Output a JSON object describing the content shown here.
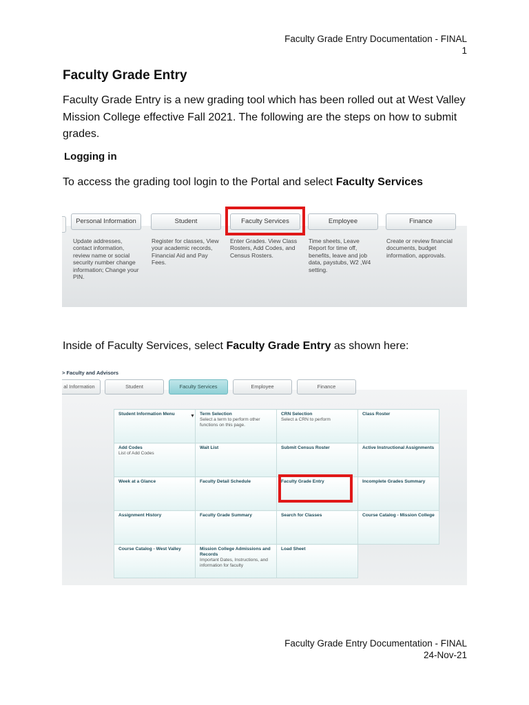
{
  "header": {
    "line1": "Faculty Grade Entry Documentation - FINAL",
    "line2": "1"
  },
  "title": "Faculty Grade Entry",
  "intro": "Faculty Grade Entry is a new grading tool which has been rolled out at West Valley Mission College effective Fall 2021.  The following are the steps on how to submit grades.",
  "logging_heading": "Logging in",
  "login_text": {
    "before": "To access the grading tool login to the Portal and select ",
    "bold": "Faculty Services"
  },
  "portal_tabs": [
    {
      "label": "Personal Information",
      "desc": "Update addresses, contact information, review name or social security number change information; Change your PIN."
    },
    {
      "label": "Student",
      "desc": "Register for classes, View your academic records, Financial Aid and Pay Fees."
    },
    {
      "label": "Faculty Services",
      "desc": "Enter Grades. View Class Rosters, Add Codes, and Census Rosters."
    },
    {
      "label": "Employee",
      "desc": "Time sheets, Leave Report for time off, benefits, leave and job data, paystubs, W2 ,W4 setting."
    },
    {
      "label": "Finance",
      "desc": "Create or review financial documents, budget information, approvals."
    }
  ],
  "inside_text": {
    "before": "Inside of Faculty Services, select ",
    "bold": "Faculty Grade Entry",
    "after": " as shown here:"
  },
  "faculty_menu": {
    "breadcrumb": "> Faculty and Advisors",
    "tabs": [
      "al Information",
      "Student",
      "Faculty Services",
      "Employee",
      "Finance"
    ],
    "rows": [
      [
        {
          "title": "Student Information Menu",
          "desc": ""
        },
        {
          "title": "Term Selection",
          "desc": "Select a term to perform other functions on this page."
        },
        {
          "title": "CRN Selection",
          "desc": "Select a CRN to perform"
        },
        {
          "title": "Class Roster",
          "desc": ""
        }
      ],
      [
        {
          "title": "Add Codes",
          "desc": "List of Add Codes"
        },
        {
          "title": "Wait List",
          "desc": ""
        },
        {
          "title": "Submit Census Roster",
          "desc": ""
        },
        {
          "title": "Active Instructional Assignments",
          "desc": ""
        }
      ],
      [
        {
          "title": "Week at a Glance",
          "desc": ""
        },
        {
          "title": "Faculty Detail Schedule",
          "desc": ""
        },
        {
          "title": "Faculty Grade Entry",
          "desc": ""
        },
        {
          "title": "Incomplete Grades Summary",
          "desc": ""
        }
      ],
      [
        {
          "title": "Assignment History",
          "desc": ""
        },
        {
          "title": "Faculty Grade Summary",
          "desc": ""
        },
        {
          "title": "Search for Classes",
          "desc": ""
        },
        {
          "title": "Course Catalog - Mission College",
          "desc": ""
        }
      ],
      [
        {
          "title": "Course Catalog - West Valley",
          "desc": ""
        },
        {
          "title": "Mission College Admissions and Records",
          "desc": "Important Dates, Instructions, and information for faculty"
        },
        {
          "title": "Load Sheet",
          "desc": ""
        }
      ]
    ]
  },
  "footer": {
    "line1": "Faculty Grade Entry Documentation - FINAL",
    "line2": "24-Nov-21"
  },
  "colors": {
    "highlight": "#e01818",
    "active_tab": "#8fd0d6",
    "cell_title": "#1e4d5a"
  }
}
